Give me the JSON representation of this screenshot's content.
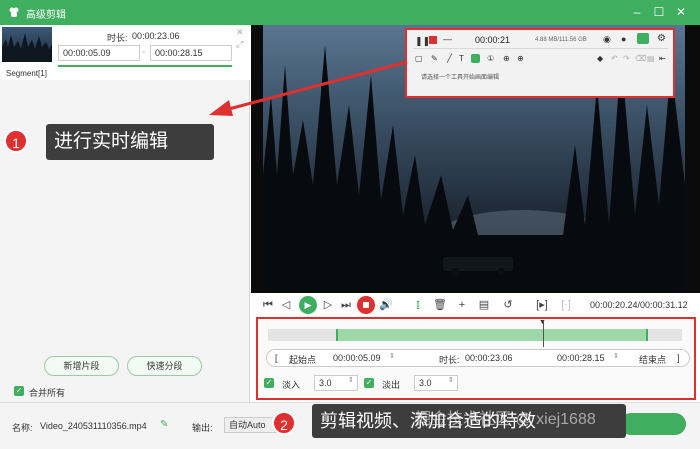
{
  "window": {
    "title": "高级剪辑"
  },
  "segment": {
    "duration_label": "时长:",
    "duration_value": "00:00:23.06",
    "start": "00:00:05.09",
    "end": "00:00:28.15",
    "name": "Segment[1]"
  },
  "left_buttons": {
    "new_segment": "新增片段",
    "quick_split": "快速分段"
  },
  "merge_all": "合并所有",
  "recorder_panel": {
    "time": "00:00:21",
    "storage": "4.88 MB/111.56 GB",
    "hint": "请选择一个工具开始画面编辑"
  },
  "playback": {
    "time": "00:00:20.24/00:00:31.12"
  },
  "editor": {
    "start_label": "起始点",
    "start_value": "00:00:05.09",
    "duration_label": "时长:",
    "duration_value": "00:00:23.06",
    "end_value": "00:00:28.15",
    "end_label": "结束点",
    "fade_in_label": "淡入",
    "fade_in_value": "3.0",
    "fade_out_label": "淡出",
    "fade_out_value": "3.0"
  },
  "bottom": {
    "name_label": "名称:",
    "file_name": "Video_240531110356.mp4",
    "output_label": "输出:",
    "output_value": "自动Auto"
  },
  "annotations": {
    "step1_number": "1",
    "step1_text": "进行实时编辑",
    "step2_number": "2",
    "step2_text": "剪辑视频、添加合适的特效",
    "watermark": "掘金技术社区 @ xiej1688"
  },
  "colors": {
    "accent": "#3fae5e",
    "highlight": "#e02f2f"
  }
}
